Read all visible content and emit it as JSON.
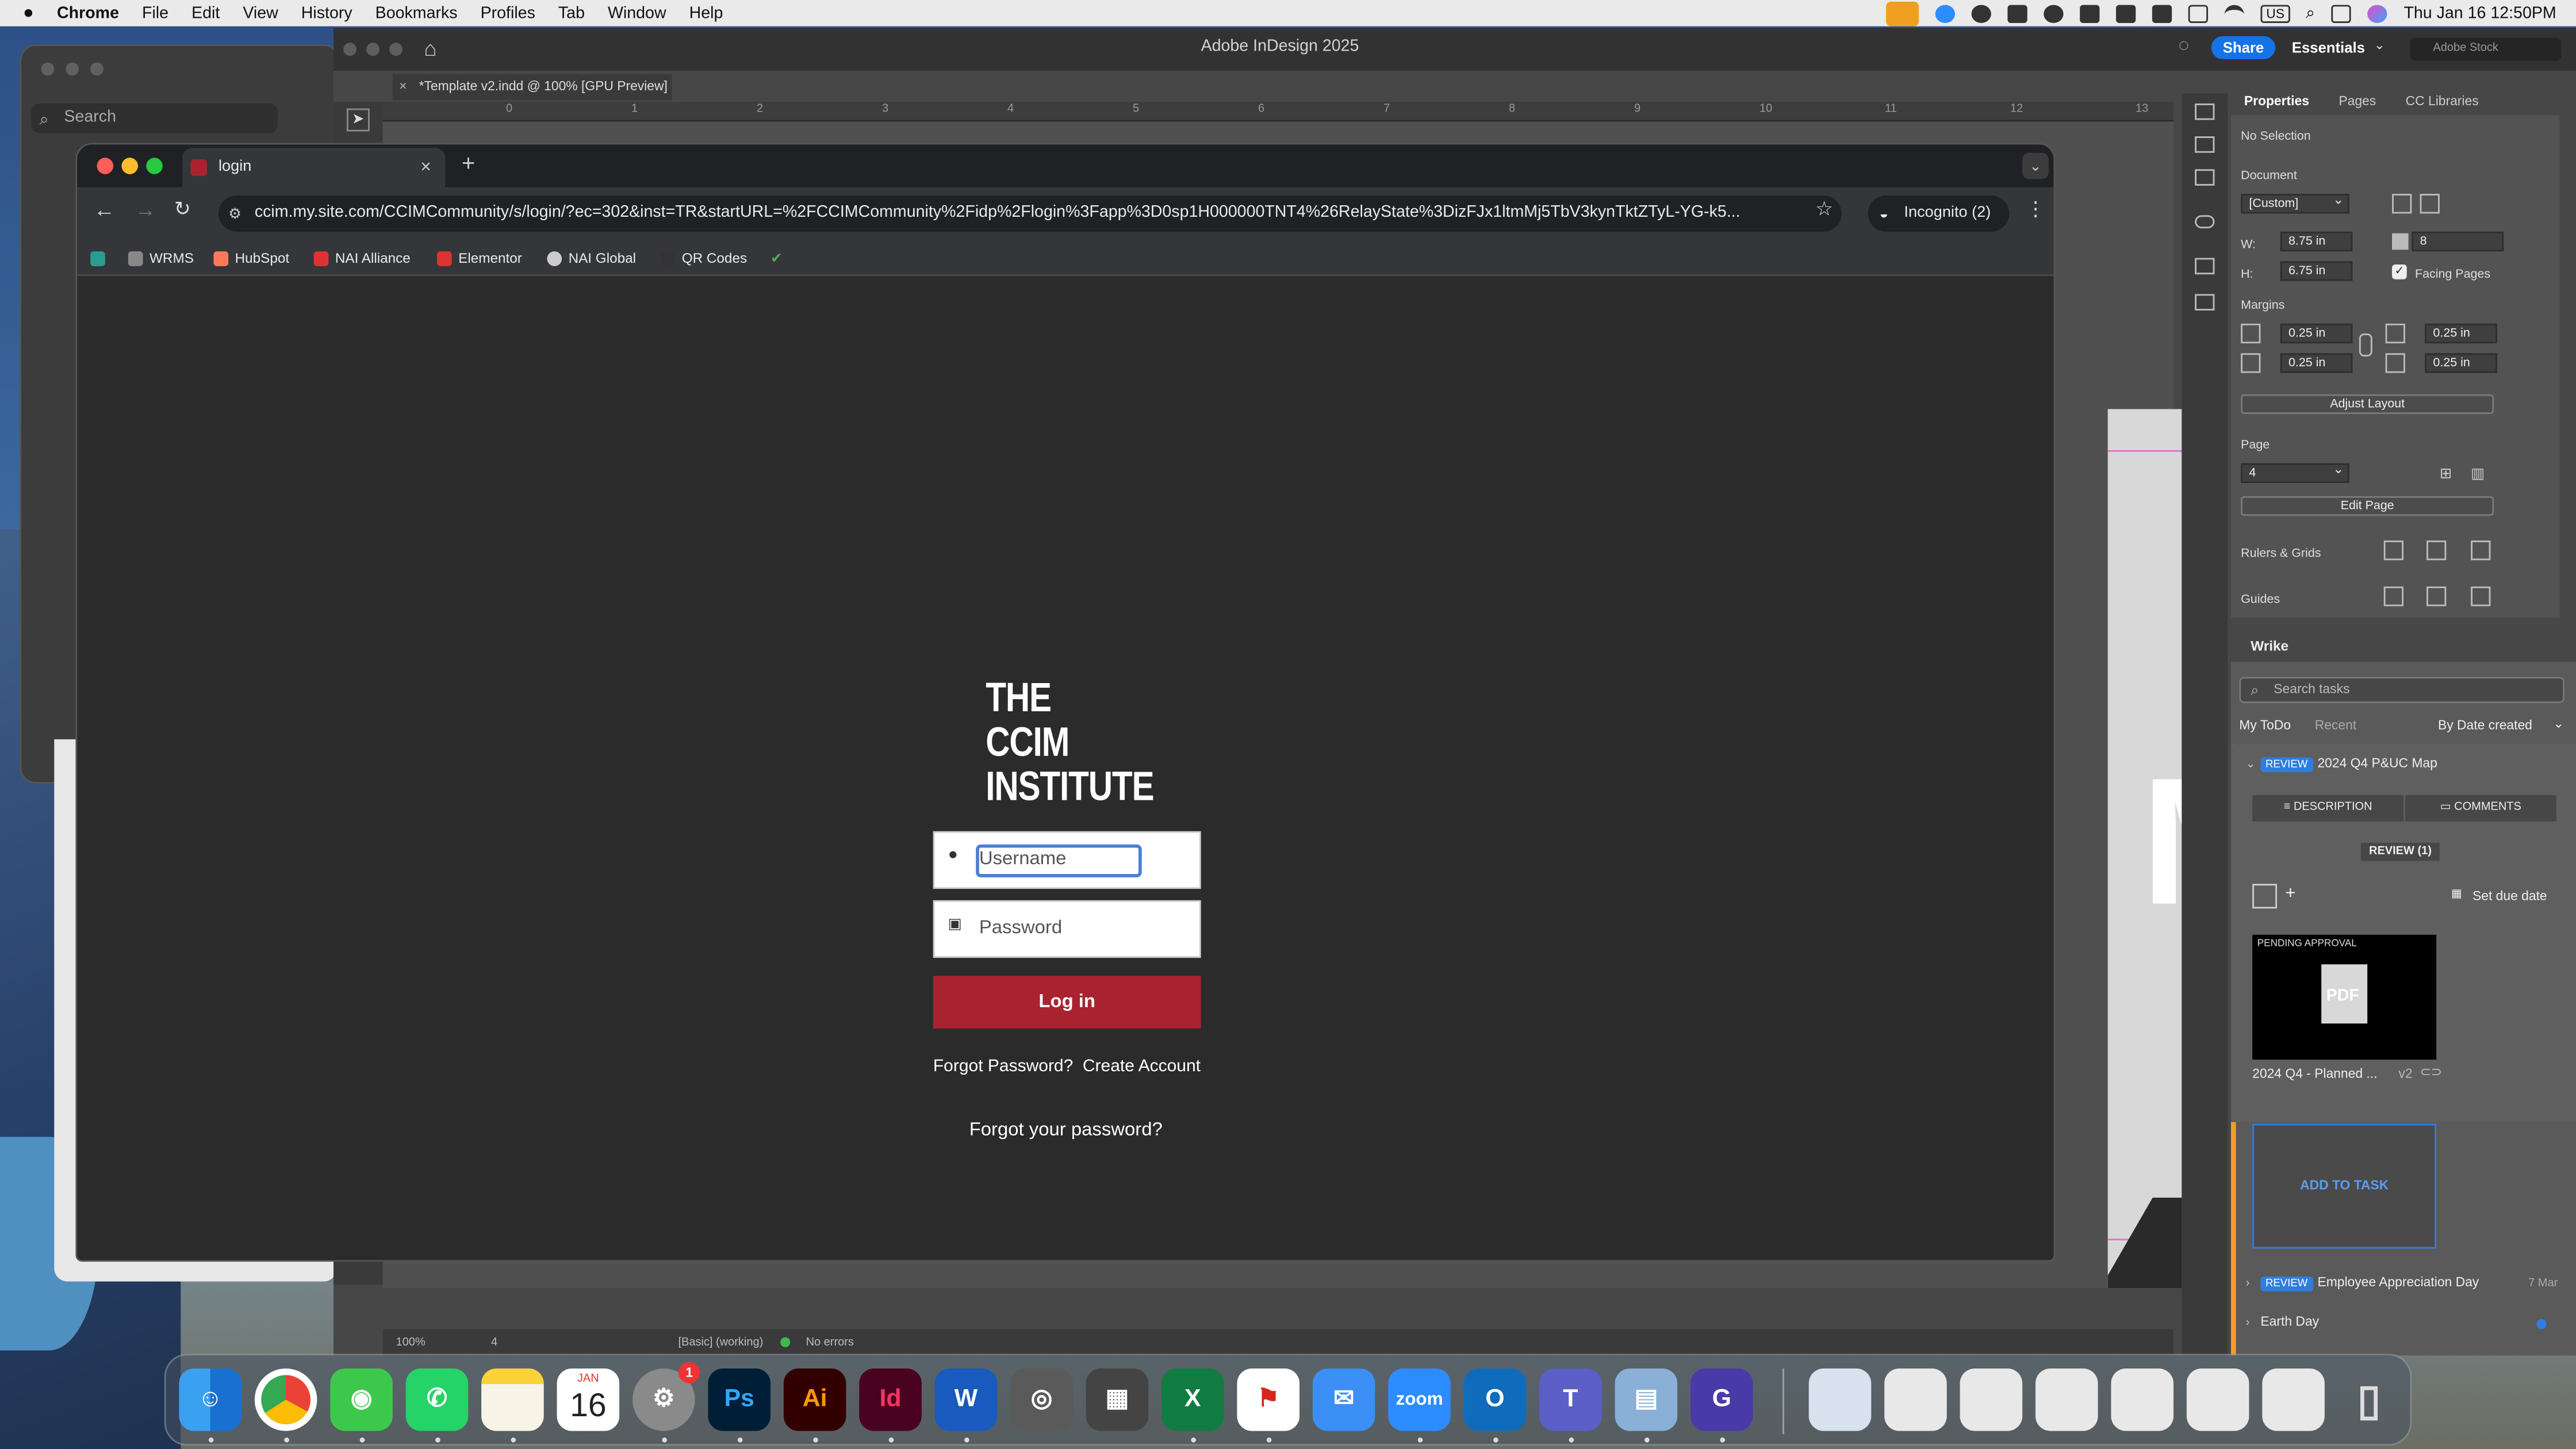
{
  "menubar": {
    "app": "Chrome",
    "items": [
      "File",
      "Edit",
      "View",
      "History",
      "Bookmarks",
      "Profiles",
      "Tab",
      "Window",
      "Help"
    ],
    "input_source": "US",
    "clock": "Thu Jan 16  12:50PM"
  },
  "finder_search": {
    "placeholder": "Search"
  },
  "indesign": {
    "title": "Adobe InDesign 2025",
    "share": "Share",
    "workspace": "Essentials",
    "stock_search": "Adobe Stock",
    "doc_tab": "*Template v2.indd @ 100% [GPU Preview]",
    "ruler_ticks": [
      "0",
      "1",
      "2",
      "3",
      "4",
      "5",
      "6",
      "7",
      "8",
      "9",
      "10",
      "11",
      "12",
      "13"
    ],
    "status": {
      "zoom": "100%",
      "page": "4",
      "style": "[Basic] (working)",
      "errors": "No errors"
    },
    "canvas_letters": "MA",
    "properties": {
      "tabs": [
        "Properties",
        "Pages",
        "CC Libraries"
      ],
      "selection": "No Selection",
      "document_label": "Document",
      "preset": "[Custom]",
      "w_label": "W:",
      "width": "8.75 in",
      "h_label": "H:",
      "height": "6.75 in",
      "pages_count": "8",
      "facing_pages": "Facing Pages",
      "margins_label": "Margins",
      "margin_top": "0.25 in",
      "margin_bottom": "0.25 in",
      "margin_left": "0.25 in",
      "margin_right": "0.25 in",
      "adjust_layout": "Adjust Layout",
      "page_label": "Page",
      "page_value": "4",
      "edit_page": "Edit Page",
      "rulers_grids": "Rulers & Grids",
      "guides": "Guides"
    },
    "wrike": {
      "title": "Wrike",
      "search_placeholder": "Search tasks",
      "tab_mytodo": "My ToDo",
      "tab_recent": "Recent",
      "sort": "By Date created",
      "task1_badge": "REVIEW",
      "task1_title": "2024 Q4 P&UC Map",
      "description": "DESCRIPTION",
      "comments": "COMMENTS",
      "review_count": "REVIEW (1)",
      "set_due_date": "Set due date",
      "pending": "PENDING APPROVAL",
      "pdf": "PDF",
      "file_name": "2024 Q4 - Planned ...",
      "file_version": "v2",
      "add_to_task": "ADD TO TASK",
      "task2_badge": "REVIEW",
      "task2_title": "Employee Appreciation Day",
      "task2_date": "7 Mar",
      "task3_title": "Earth Day"
    }
  },
  "chrome": {
    "tab_title": "login",
    "url": "ccim.my.site.com/CCIMCommunity/s/login/?ec=302&inst=TR&startURL=%2FCCIMCommunity%2Fidp%2Flogin%3Fapp%3D0sp1H000000TNT4%26RelayState%3DizFJx1ltmMj5TbV3kynTktZTyL-YG-k5...",
    "incognito": "Incognito (2)",
    "bookmarks": [
      "WRMS",
      "HubSpot",
      "NAI Alliance",
      "Elementor",
      "NAI Global",
      "QR Codes"
    ],
    "page": {
      "logo_lines": [
        "THE",
        "CCIM",
        "INSTITUTE"
      ],
      "username_placeholder": "Username",
      "password_placeholder": "Password",
      "login": "Log in",
      "forgot": "Forgot Password?",
      "create": "Create Account",
      "forgot2": "Forgot your password?"
    }
  },
  "dock": {
    "calendar_month": "JAN",
    "calendar_day": "16",
    "settings_badge": "1",
    "apps": [
      "Finder",
      "Chrome",
      "Messages",
      "WhatsApp",
      "Notes",
      "Calendar",
      "System Settings",
      "Photoshop",
      "Illustrator",
      "InDesign",
      "Word",
      "Screenshot",
      "Calculator",
      "Excel",
      "Acrobat",
      "Mail",
      "Zoom",
      "Outlook",
      "Teams",
      "Preview",
      "Grammarly"
    ],
    "ps": "Ps",
    "ai": "Ai",
    "id": "Id",
    "w": "W",
    "x": "X",
    "zoom": "zoom",
    "o": "O",
    "t": "T",
    "g": "G"
  },
  "colors": {
    "login_button": "#a8232f",
    "wrike_badge": "#2f7de1",
    "incognito_bg": "#202124"
  }
}
